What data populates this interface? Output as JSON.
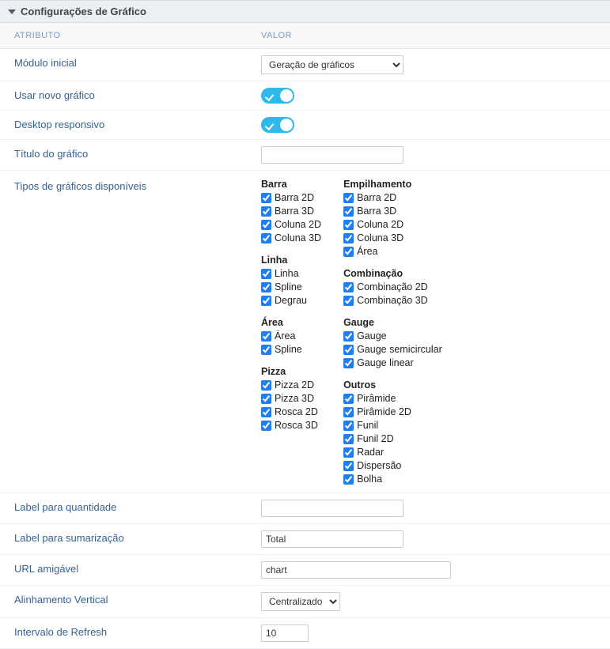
{
  "panel": {
    "title": "Configurações de Gráfico"
  },
  "columns": {
    "attr": "ATRIBUTO",
    "val": "VALOR"
  },
  "rows": {
    "modulo": {
      "label": "Módulo inicial",
      "value": "Geração de gráficos"
    },
    "novo": {
      "label": "Usar novo gráfico"
    },
    "responsivo": {
      "label": "Desktop responsivo"
    },
    "titulo": {
      "label": "Título do gráfico",
      "value": ""
    },
    "tipos": {
      "label": "Tipos de gráficos disponíveis"
    },
    "labelQtd": {
      "label": "Label para quantidade",
      "value": ""
    },
    "labelSum": {
      "label": "Label para sumarização",
      "value": "Total"
    },
    "url": {
      "label": "URL amigável",
      "value": "chart"
    },
    "alin": {
      "label": "Alinhamento Vertical",
      "value": "Centralizado"
    },
    "refresh": {
      "label": "Intervalo de Refresh",
      "value": "10"
    }
  },
  "groupsLeft": [
    {
      "title": "Barra",
      "items": [
        "Barra 2D",
        "Barra 3D",
        "Coluna 2D",
        "Coluna 3D"
      ]
    },
    {
      "title": "Linha",
      "items": [
        "Linha",
        "Spline",
        "Degrau"
      ]
    },
    {
      "title": "Área",
      "items": [
        "Área",
        "Spline"
      ]
    },
    {
      "title": "Pizza",
      "items": [
        "Pizza 2D",
        "Pizza 3D",
        "Rosca 2D",
        "Rosca 3D"
      ]
    }
  ],
  "groupsRight": [
    {
      "title": "Empilhamento",
      "items": [
        "Barra 2D",
        "Barra 3D",
        "Coluna 2D",
        "Coluna 3D",
        "Área"
      ]
    },
    {
      "title": "Combinação",
      "items": [
        "Combinação 2D",
        "Combinação 3D"
      ]
    },
    {
      "title": "Gauge",
      "items": [
        "Gauge",
        "Gauge semicircular",
        "Gauge linear"
      ]
    },
    {
      "title": "Outros",
      "items": [
        "Pirâmide",
        "Pirâmide 2D",
        "Funil",
        "Funil 2D",
        "Radar",
        "Dispersão",
        "Bolha"
      ]
    }
  ]
}
